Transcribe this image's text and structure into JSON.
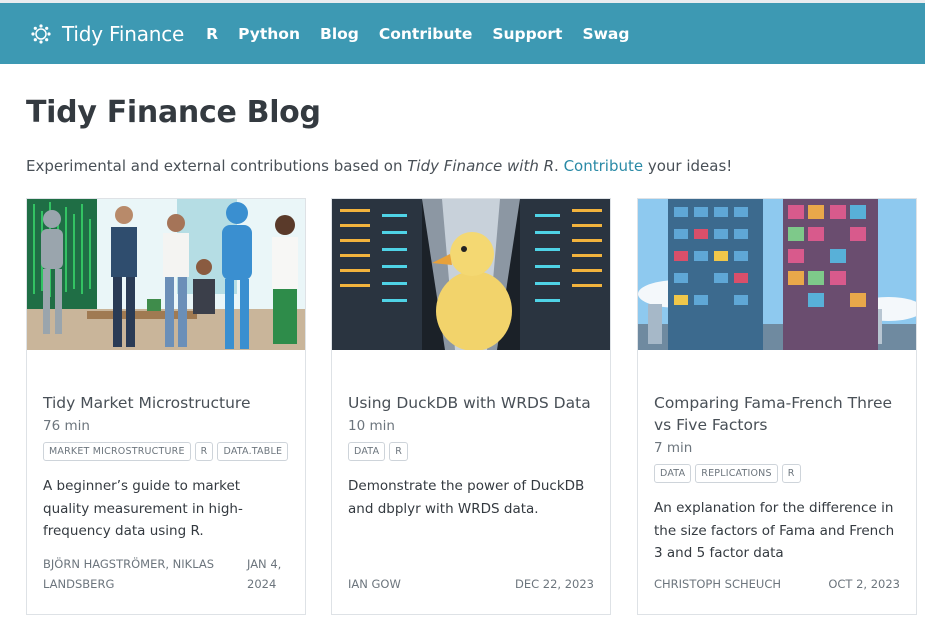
{
  "navbar": {
    "brand": "Tidy Finance",
    "links": [
      "R",
      "Python",
      "Blog",
      "Contribute",
      "Support",
      "Swag"
    ]
  },
  "page": {
    "title": "Tidy Finance Blog",
    "subtitle_prefix": "Experimental and external contributions based on ",
    "subtitle_italic": "Tidy Finance with R",
    "subtitle_mid": ". ",
    "subtitle_link": "Contribute",
    "subtitle_suffix": " your ideas!"
  },
  "cards": [
    {
      "title": "Tidy Market Microstructure",
      "reading_time": "76 min",
      "categories": [
        "MARKET MICROSTRUCTURE",
        "R",
        "DATA.TABLE"
      ],
      "description": "A beginner’s guide to market quality measurement in high-frequency data using R.",
      "author": "BJÖRN HAGSTRÖMER, NIKLAS LANDSBERG",
      "date": "JAN 4, 2024"
    },
    {
      "title": "Using DuckDB with WRDS Data",
      "reading_time": "10 min",
      "categories": [
        "DATA",
        "R"
      ],
      "description": "Demonstrate the power of DuckDB and dbplyr with WRDS data.",
      "author": "IAN GOW",
      "date": "DEC 22, 2023"
    },
    {
      "title": "Comparing Fama-French Three vs Five Factors",
      "reading_time": "7 min",
      "categories": [
        "DATA",
        "REPLICATIONS",
        "R"
      ],
      "description": "An explanation for the difference in the size factors of Fama and French 3 and 5 factor data",
      "author": "CHRISTOPH SCHEUCH",
      "date": "OCT 2, 2023"
    }
  ],
  "colors": {
    "navbar": "#3d99b3",
    "link": "#2a8aa6",
    "text": "#343a40",
    "muted": "#6c757d"
  }
}
